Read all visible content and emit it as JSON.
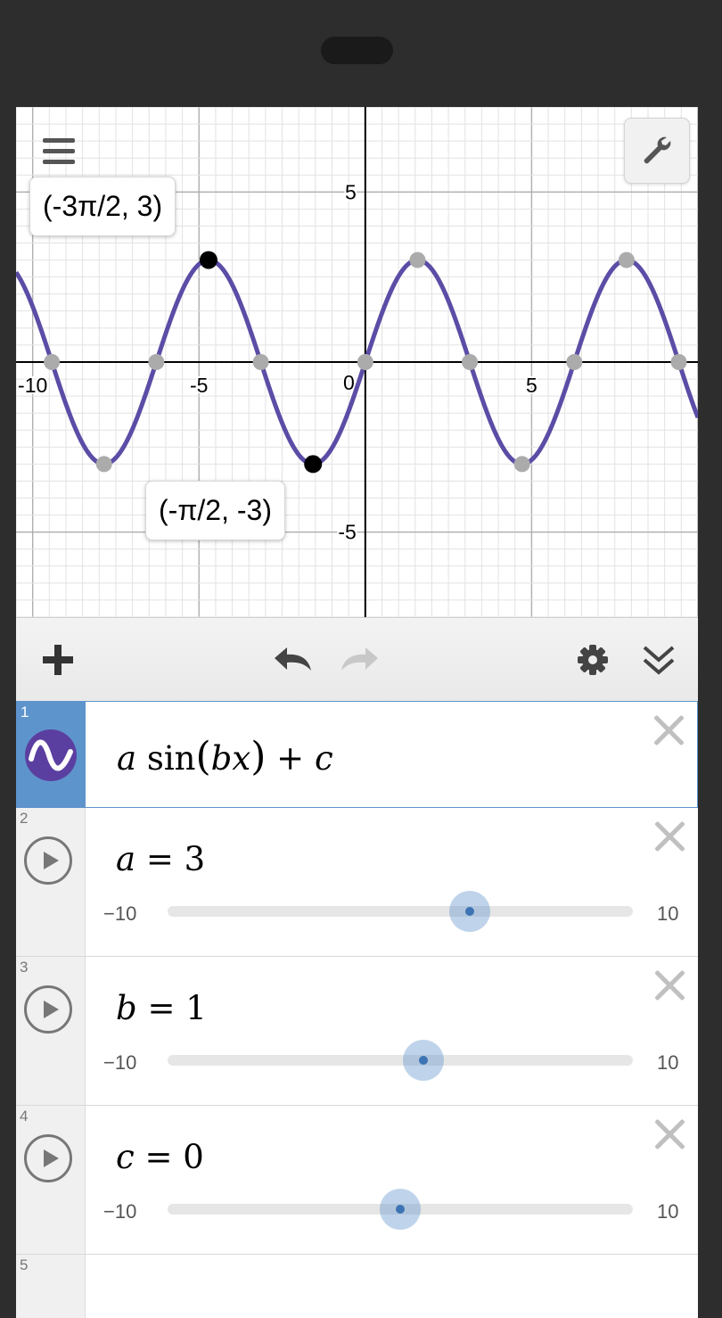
{
  "graph": {
    "x_range": [
      -10.5,
      10
    ],
    "y_range": [
      -7.5,
      7.5
    ],
    "x_ticks": [
      {
        "value": -10,
        "label": "-10"
      },
      {
        "value": -5,
        "label": "-5"
      },
      {
        "value": 5,
        "label": "5"
      }
    ],
    "y_ticks": [
      {
        "value": 5,
        "label": "5"
      },
      {
        "value": -5,
        "label": "-5"
      }
    ],
    "origin_label": "0",
    "curve_color": "#5b4da6",
    "point_gray": "#ababab",
    "point_black": "#000000",
    "labeled_points": [
      {
        "x": -4.712,
        "y": 3,
        "label": "(-3π/2, 3)"
      },
      {
        "x": -1.571,
        "y": -3,
        "label": "(-π/2, -3)"
      }
    ]
  },
  "toolbar": {
    "add_icon": "plus-icon",
    "undo_icon": "undo-icon",
    "redo_icon": "redo-icon",
    "settings_icon": "gear-icon",
    "collapse_icon": "double-chevron-down-icon"
  },
  "expressions": [
    {
      "index": "1",
      "type": "function",
      "latex": "a sin(bx) + c",
      "parts": {
        "a": "a",
        "sin": "sin",
        "lp": "(",
        "bx": "bx",
        "rp": ")",
        "plus": "+",
        "c": "c"
      },
      "icon": "sine-wave-icon"
    },
    {
      "index": "2",
      "type": "slider",
      "var": "a",
      "eq": "=",
      "value": "3",
      "numeric": 3,
      "min": "−10",
      "max": "10"
    },
    {
      "index": "3",
      "type": "slider",
      "var": "b",
      "eq": "=",
      "value": "1",
      "numeric": 1,
      "min": "−10",
      "max": "10"
    },
    {
      "index": "4",
      "type": "slider",
      "var": "c",
      "eq": "=",
      "value": "0",
      "numeric": 0,
      "min": "−10",
      "max": "10"
    },
    {
      "index": "5",
      "type": "empty"
    }
  ],
  "colors": {
    "accent": "#5e94cc",
    "slider_thumb": "#3d74b4"
  }
}
